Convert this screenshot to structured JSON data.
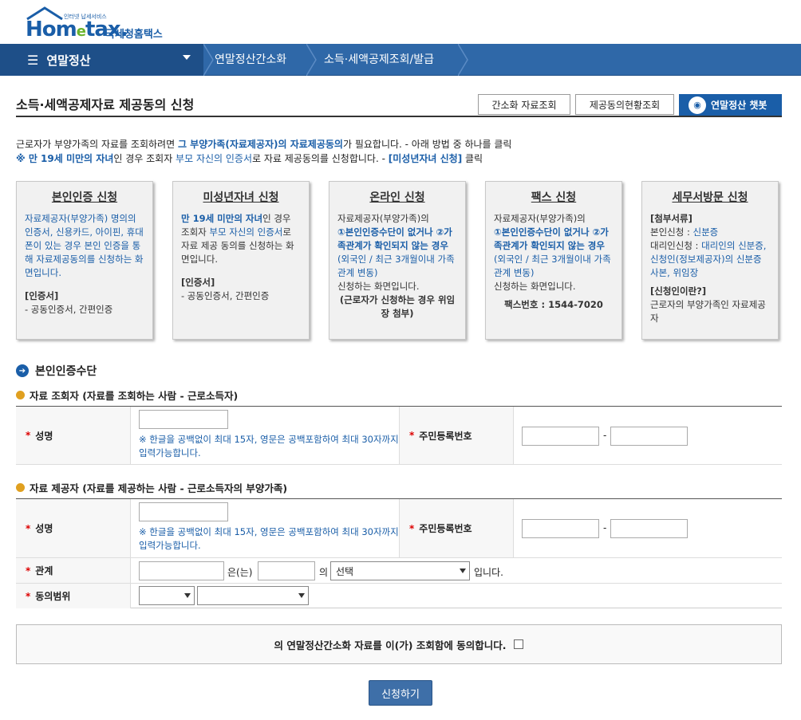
{
  "header": {
    "logo_tiny": "인터넷 납세서비스",
    "logo_home": "Hom",
    "logo_e": "e",
    "logo_tax": "tax.",
    "logo_kr": "국세청홈택스"
  },
  "nav": {
    "menu_label": "연말정산",
    "crumb1": "연말정산간소화",
    "crumb2": "소득·세액공제조회/발급"
  },
  "page": {
    "title": "소득·세액공제자료 제공동의 신청",
    "btn_simple": "간소화 자료조회",
    "btn_status": "제공동의현황조회",
    "btn_chatbot": "연말정산 챗봇"
  },
  "intro": {
    "line1_a": "근로자가 부양가족의 자료를 조회하려면 ",
    "line1_b": "그 부양가족(자료제공자)의 자료제공동의",
    "line1_c": "가 필요합니다. - 아래 방법 중 하나를 클릭",
    "line2_a": "※ 만 19세 미만의 자녀",
    "line2_b": "인 경우 조회자 ",
    "line2_c": "부모 자신의 인증서",
    "line2_d": "로 자료 제공동의를 신청합니다. - ",
    "line2_e": "[미성년자녀 신청]",
    "line2_f": " 클릭"
  },
  "cards": [
    {
      "title": "본인인증 신청",
      "p1": "자료제공자(부양가족) 명의의 인증서, 신용카드, 아이핀,  휴대폰이 있는 경우 본인 인증을 통해 자료제공동의를 신청하는 화면입니다.",
      "h2": "[인증서]",
      "p2": "- 공동인증서, 간편인증"
    },
    {
      "title": "미성년자녀 신청",
      "p1a": "만 19세 미만의 자녀",
      "p1b": "인 경우 조회자 ",
      "p1c": "부모 자신의 인증서",
      "p1d": "로 자료 제공 동의를 신청하는 화면입니다.",
      "h2": "[인증서]",
      "p2": "- 공동인증서, 간편인증"
    },
    {
      "title": "온라인 신청",
      "p1": "자료제공자(부양가족)의",
      "p2": "①본인인증수단이 없거나 ②가족관계가 확인되지 않는 경우",
      "p3": "(외국인 / 최근 3개월이내 가족관계 변동)",
      "p4": "신청하는 화면입니다.",
      "p5": "(근로자가 신청하는 경우 위임장 첨부)"
    },
    {
      "title": "팩스 신청",
      "p1": "자료제공자(부양가족)의",
      "p2": "①본인인증수단이 없거나 ②가족관계가 확인되지 않는 경우",
      "p3": "(외국인 / 최근 3개월이내 가족관계 변동)",
      "p4": "신청하는 화면입니다.",
      "p5": "팩스번호 : 1544-7020"
    },
    {
      "title": "세무서방문 신청",
      "h1": "[첨부서류]",
      "p1a": "본인신청 : ",
      "p1b": "신분증",
      "p2a": "대리인신청 : ",
      "p2b": "대리인의 신분증, 신청인(정보제공자)의 신분증 사본, 위임장",
      "h2": "[신청인이란?]",
      "p3": "근로자의 부양가족인 자료제공자"
    }
  ],
  "section": {
    "title": "본인인증수단",
    "viewer_heading": "자료 조회자 (자료를 조회하는 사람 - 근로소득자)",
    "provider_heading": "자료 제공자 (자료를 제공하는 사람 - 근로소득자의 부양가족)"
  },
  "form": {
    "req": "*",
    "name_label": "성명",
    "rrn_label": "주민등록번호",
    "name_note": "※ 한글을 공백없이 최대 15자, 영문은 공백포함하여 최대 30자까지 입력가능합니다.",
    "dash": "-",
    "relation_label": "관계",
    "relation_eun": "은(는)",
    "relation_ui": "의",
    "relation_select": "선택",
    "relation_end": "입니다.",
    "scope_label": "동의범위",
    "scope_select1": "",
    "scope_select2": ""
  },
  "agree": {
    "text": "의 연말정산간소화 자료를 이(가) 조회함에 동의합니다."
  },
  "submit_label": "신청하기"
}
